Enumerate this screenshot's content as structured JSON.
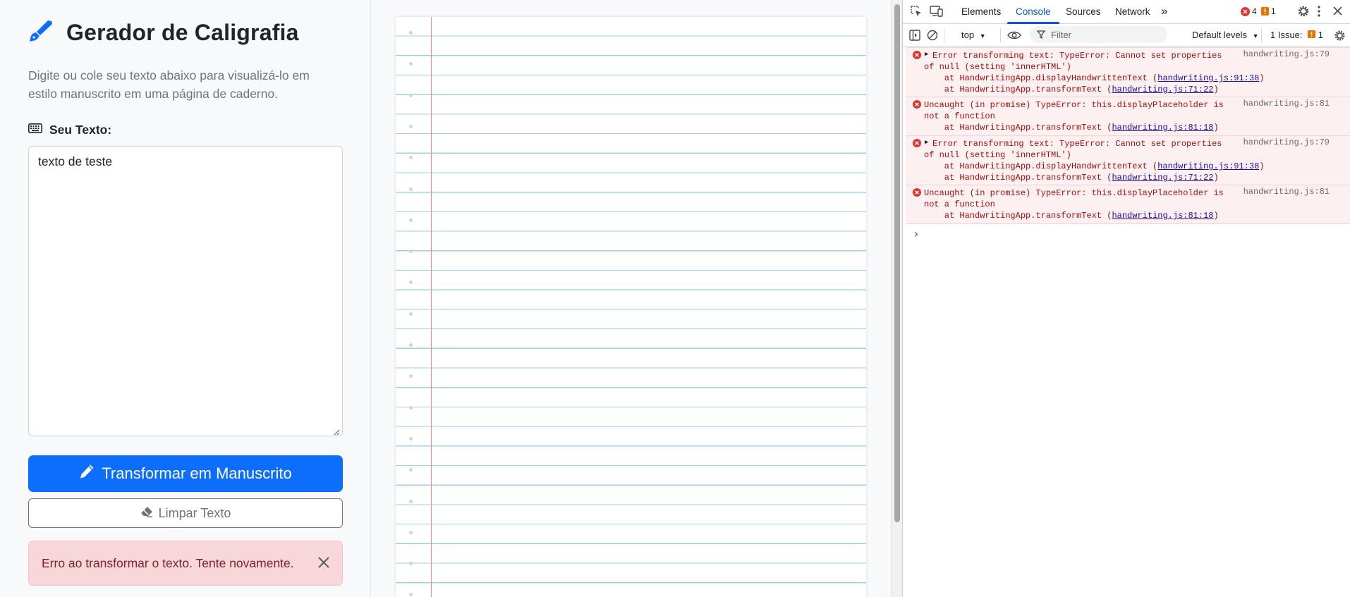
{
  "app": {
    "title": "Gerador de Caligrafia",
    "description": "Digite ou cole seu texto abaixo para visualizá-lo em estilo manuscrito em uma página de caderno.",
    "input_label": "Seu Texto:",
    "input_value": "texto de teste",
    "transform_button": "Transformar em Manuscrito",
    "clear_button": "Limpar Texto",
    "error_message": "Erro ao transformar o texto. Tente novamente.",
    "accent_color": "#0d6efd",
    "error_color": "#842029"
  },
  "notebook": {
    "line_color": "#9ecfe6",
    "margin_color": "#f08b8b"
  },
  "devtools": {
    "tabs": [
      "Elements",
      "Console",
      "Sources",
      "Network"
    ],
    "active_tab": "Console",
    "more_tabs": "»",
    "error_count": "4",
    "warning_count": "1",
    "context": "top",
    "filter_placeholder": "Filter",
    "levels": "Default levels",
    "issues_label": "1 Issue:",
    "issues_count": "1",
    "messages": [
      {
        "expandable": true,
        "line1": "Error transforming text: TypeError: Cannot set properties",
        "line2": "of null (setting 'innerHTML')",
        "stack": [
          {
            "prefix": "    at HandwritingApp.displayHandwrittenText (",
            "link": "handwriting.js:91:38",
            "suffix": ")"
          },
          {
            "prefix": "    at HandwritingApp.transformText (",
            "link": "handwriting.js:71:22",
            "suffix": ")"
          }
        ],
        "source": "handwriting.js:79"
      },
      {
        "expandable": false,
        "line1": "Uncaught (in promise) TypeError: this.displayPlaceholder is",
        "line2": "not a function",
        "stack": [
          {
            "prefix": "    at HandwritingApp.transformText (",
            "link": "handwriting.js:81:18",
            "suffix": ")"
          }
        ],
        "source": "handwriting.js:81"
      },
      {
        "expandable": true,
        "line1": "Error transforming text: TypeError: Cannot set properties",
        "line2": "of null (setting 'innerHTML')",
        "stack": [
          {
            "prefix": "    at HandwritingApp.displayHandwrittenText (",
            "link": "handwriting.js:91:38",
            "suffix": ")"
          },
          {
            "prefix": "    at HandwritingApp.transformText (",
            "link": "handwriting.js:71:22",
            "suffix": ")"
          }
        ],
        "source": "handwriting.js:79"
      },
      {
        "expandable": false,
        "line1": "Uncaught (in promise) TypeError: this.displayPlaceholder is",
        "line2": "not a function",
        "stack": [
          {
            "prefix": "    at HandwritingApp.transformText (",
            "link": "handwriting.js:81:18",
            "suffix": ")"
          }
        ],
        "source": "handwriting.js:81"
      }
    ],
    "prompt_symbol": "›"
  }
}
